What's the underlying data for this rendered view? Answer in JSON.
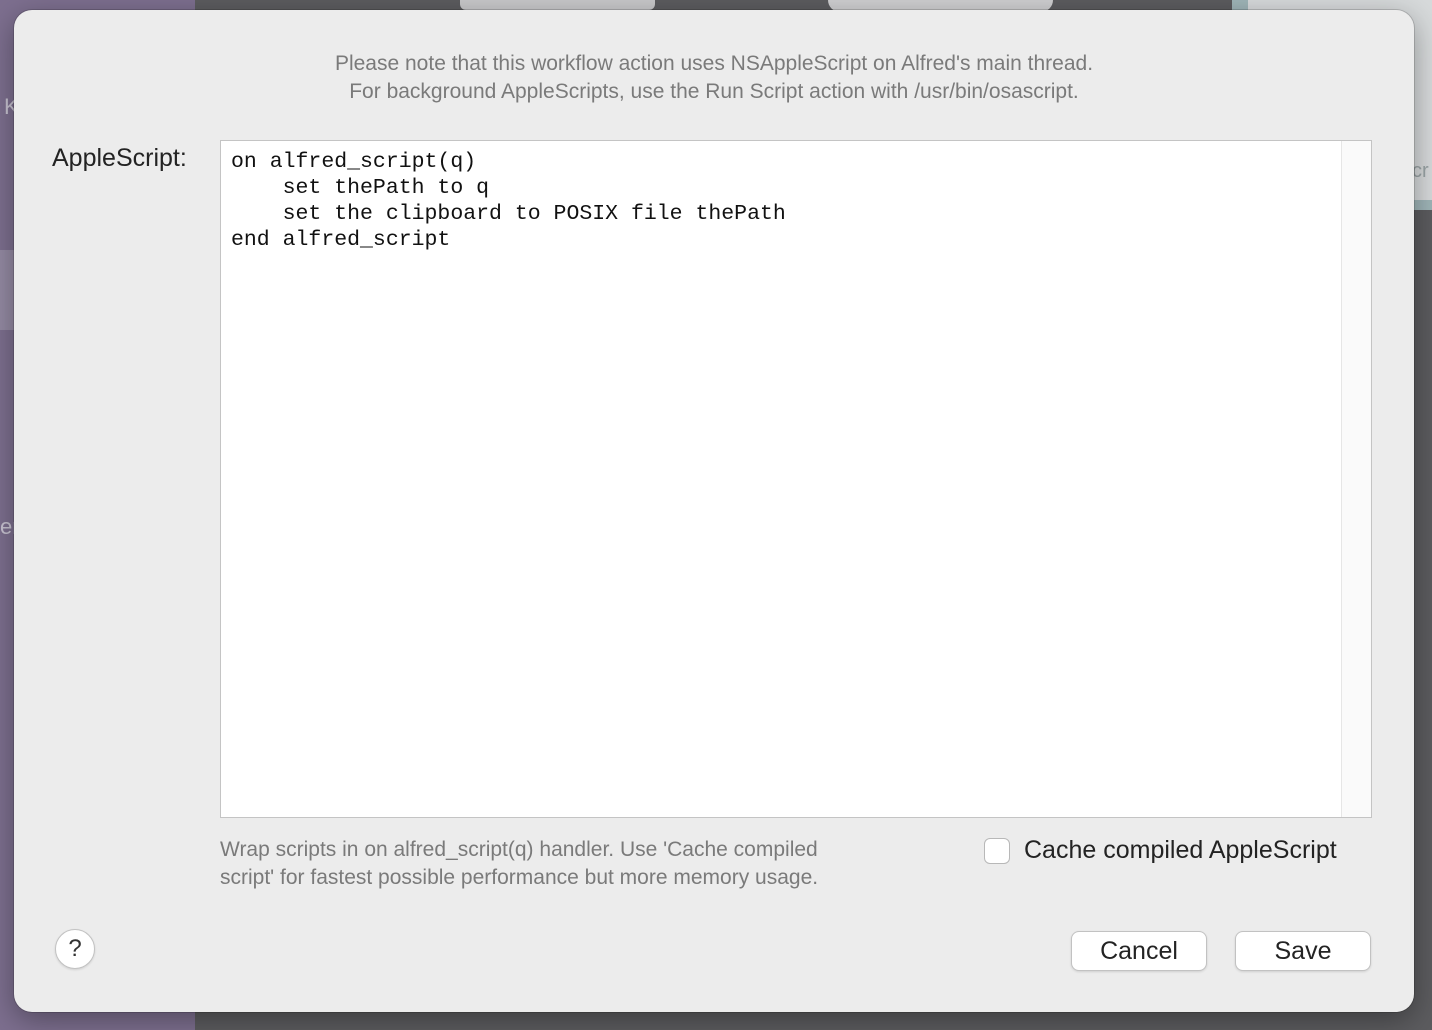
{
  "background": {
    "fragment_left_top": "K",
    "fragment_left_mid": "er",
    "fragment_right": "cr"
  },
  "dialog": {
    "note_line1": "Please note that this workflow action uses NSAppleScript on Alfred's main thread.",
    "note_line2": "For background AppleScripts, use the Run Script action with /usr/bin/osascript.",
    "field_label": "AppleScript:",
    "script": "on alfred_script(q)\n    set thePath to q\n    set the clipboard to POSIX file thePath\nend alfred_script",
    "hint_line1": "Wrap scripts in on alfred_script(q) handler. Use 'Cache compiled",
    "hint_line2": "script' for fastest possible performance but more memory usage.",
    "cache_checkbox": {
      "label": "Cache compiled AppleScript",
      "checked": false
    },
    "help_label": "?",
    "cancel_label": "Cancel",
    "save_label": "Save"
  }
}
